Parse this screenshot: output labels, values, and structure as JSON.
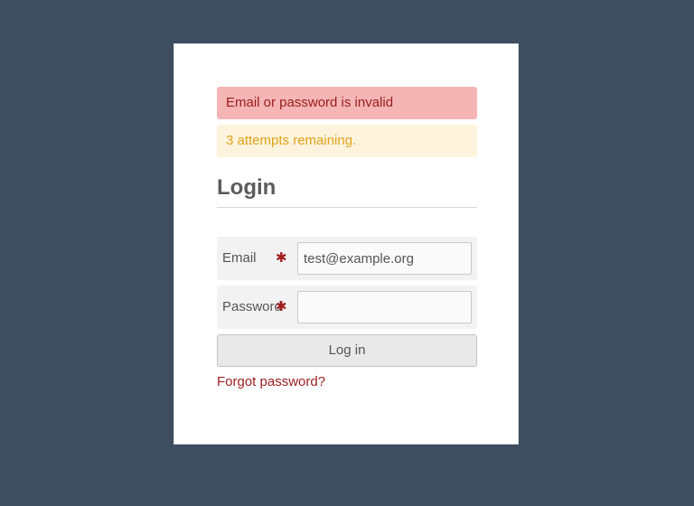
{
  "alerts": {
    "error": "Email or password is invalid",
    "warning": "3 attempts remaining."
  },
  "form": {
    "title": "Login",
    "email_label": "Email",
    "email_value": "test@example.org",
    "password_label": "Password",
    "password_value": "",
    "required_marker": "✱",
    "submit_label": "Log in",
    "forgot_label": "Forgot password?"
  },
  "colors": {
    "background": "#3e4d60",
    "error_bg": "#f5b5b5",
    "error_text": "#9a1d1d",
    "warning_bg": "#fef4dd",
    "warning_text": "#e0a21a",
    "link": "#9a1d1d"
  }
}
